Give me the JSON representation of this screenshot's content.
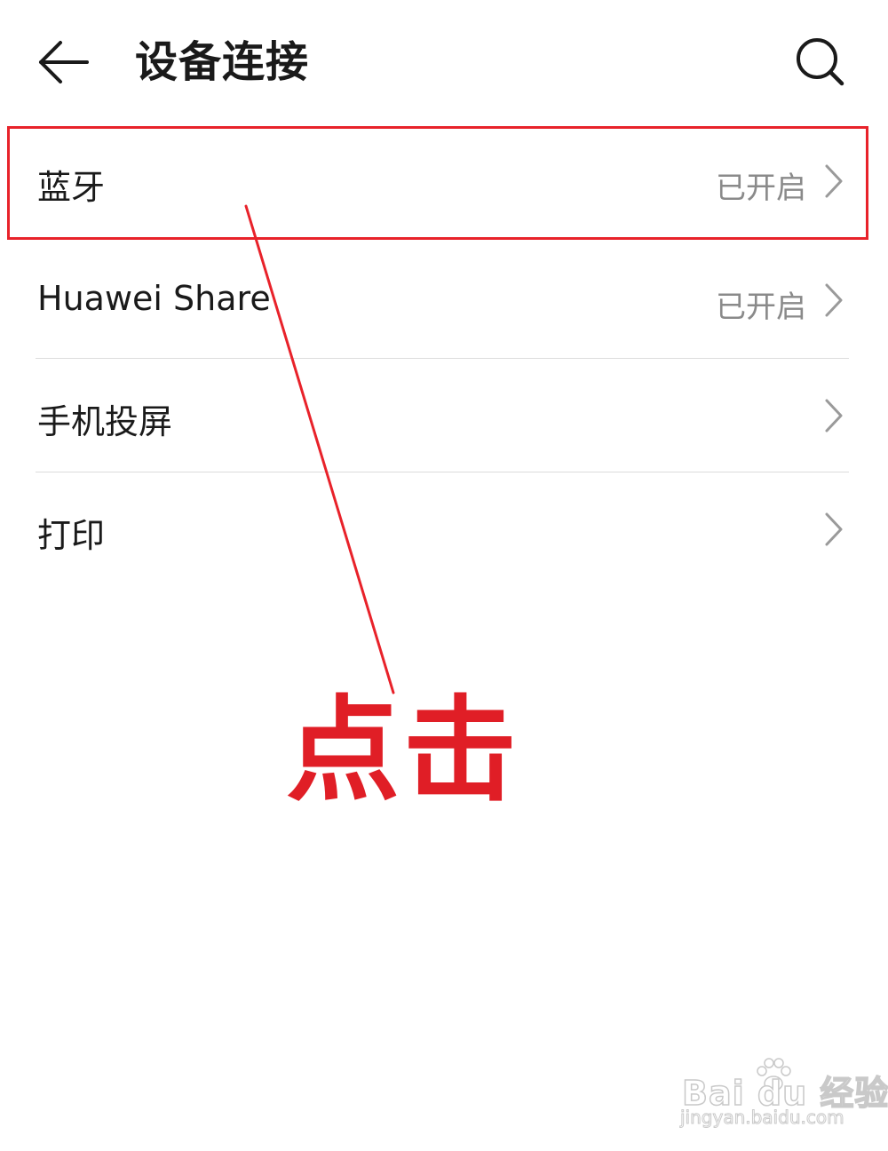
{
  "header": {
    "title": "设备连接",
    "back_icon": "arrow-left-icon",
    "search_icon": "search-icon"
  },
  "settings": {
    "items": [
      {
        "label": "蓝牙",
        "status": "已开启",
        "icon": "chevron-right-icon"
      },
      {
        "label": "Huawei Share",
        "status": "已开启",
        "icon": "chevron-right-icon"
      },
      {
        "label": "手机投屏",
        "status": "",
        "icon": "chevron-right-icon"
      },
      {
        "label": "打印",
        "status": "",
        "icon": "chevron-right-icon"
      }
    ]
  },
  "annotation": {
    "text": "点击",
    "color": "#e01e26"
  },
  "watermark": {
    "logo": "Bai du 经验",
    "url": "jingyan.baidu.com"
  },
  "colors": {
    "primary_text": "#1a1a1a",
    "secondary_text": "#8a8a8a",
    "divider": "#dcdcdc",
    "annotation_red": "#e8222a"
  }
}
